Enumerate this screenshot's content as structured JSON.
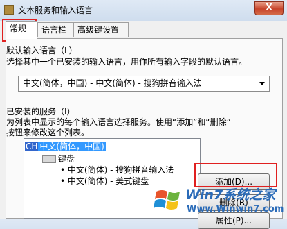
{
  "window": {
    "title": "文本服务和输入语言",
    "close_label": "X"
  },
  "tabs": [
    {
      "label": "常规",
      "active": true
    },
    {
      "label": "语言栏",
      "active": false
    },
    {
      "label": "高级键设置",
      "active": false
    }
  ],
  "default_language": {
    "group_label": "默认输入语言（L）",
    "description": "选择其中一个已安装的输入语言，用作所有输入字段的默认语言。",
    "selected_value": "中文(简体，中国) - 中文(简体) - 搜狗拼音输入法"
  },
  "installed_services": {
    "group_label": "已安装的服务（I）",
    "description_line1": "为列表中显示的每个输入语言选择服务。使用“添加”和“删除”",
    "description_line2": "按钮来修改这个列表。",
    "tree": {
      "language_code": "CH",
      "language_name": "中文(简体，中国)",
      "category": "键盘",
      "items": [
        "中文(简体) - 搜狗拼音输入法",
        "中文(简体) - 美式键盘"
      ]
    },
    "buttons": {
      "add": "添加(D)...",
      "remove": "删除(R)",
      "properties": "属性(P)..."
    }
  },
  "watermark": {
    "line1": "Win7系统之家",
    "line2": "Www.Winwin7.com"
  },
  "colors": {
    "highlight_red": "#e02020",
    "selection_blue": "#3399ff",
    "watermark_blue": "#2a6bb8"
  }
}
